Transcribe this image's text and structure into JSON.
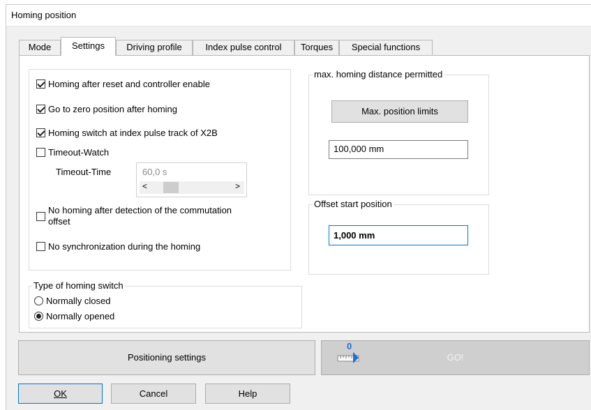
{
  "window": {
    "title": "Homing position"
  },
  "tabs": [
    {
      "label": "Mode"
    },
    {
      "label": "Settings"
    },
    {
      "label": "Driving profile"
    },
    {
      "label": "Index pulse control"
    },
    {
      "label": "Torques"
    },
    {
      "label": "Special functions"
    }
  ],
  "options": {
    "homing_after_reset": {
      "label": "Homing after reset and controller enable",
      "checked": true
    },
    "go_to_zero": {
      "label": "Go to zero position after homing",
      "checked": true
    },
    "homing_switch_index": {
      "label": "Homing switch at index pulse track of X2B",
      "checked": true
    },
    "timeout_watch": {
      "label": "Timeout-Watch",
      "checked": false
    },
    "timeout_time": {
      "label": "Timeout-Time",
      "value": "60,0 s"
    },
    "no_homing_commutation": {
      "label_line1": "No homing after detection of the commutation",
      "label_line2": "offset",
      "checked": false
    },
    "no_sync": {
      "label": "No synchronization during the homing",
      "checked": false
    }
  },
  "switch_type": {
    "title": "Type of homing switch",
    "normally_closed": "Normally closed",
    "normally_opened": "Normally opened",
    "selected": "Normally opened"
  },
  "max_distance": {
    "title": "max. homing distance permitted",
    "button": "Max. position limits",
    "value": "100,000 mm"
  },
  "offset": {
    "title": "Offset start position",
    "value": "1,000 mm"
  },
  "bottom": {
    "positioning_settings": "Positioning settings",
    "go_label": "GO!",
    "go_icon_digit": "0"
  },
  "dialog": {
    "ok": "OK",
    "cancel": "Cancel",
    "help": "Help"
  },
  "colors": {
    "focus_border": "#0078d7",
    "go_button_bg": "#cfcfcf",
    "ruler_blue": "#1e6fd9"
  }
}
